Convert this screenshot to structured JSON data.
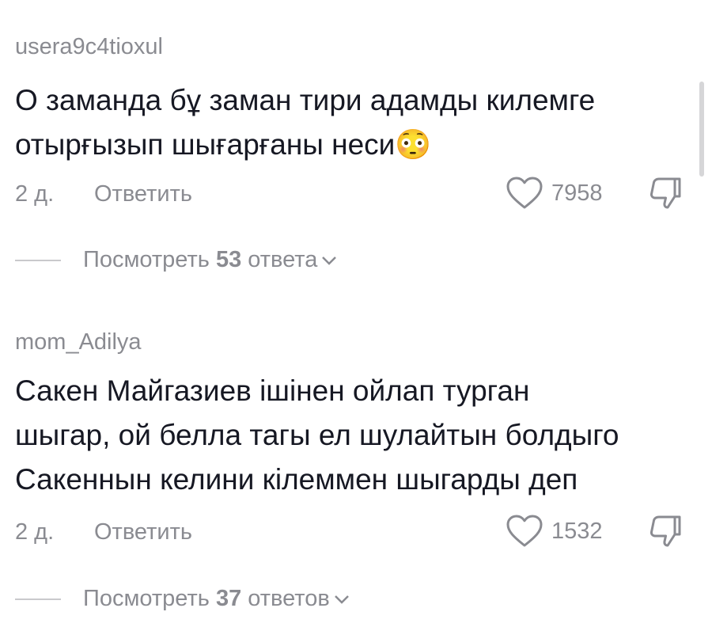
{
  "comments": [
    {
      "username": "usera9c4tioxul",
      "text_lines": [
        "О заманда бұ заман тири адамды килемге",
        "отырғызып шығарғаны неси😳"
      ],
      "time": "2 д.",
      "reply_label": "Ответить",
      "like_count": "7958",
      "replies_prefix": "Посмотреть ",
      "replies_count": "53",
      "replies_suffix": " ответа"
    },
    {
      "username": "mom_Adilya",
      "text_lines": [
        "Сакен Майгазиев ішінен ойлап турган",
        "шыгар, ой белла тагы ел шулайтын болдыго",
        "Сакеннын келини кілеммен шыгарды деп"
      ],
      "time": "2 д.",
      "reply_label": "Ответить",
      "like_count": "1532",
      "replies_prefix": "Посмотреть ",
      "replies_count": "37",
      "replies_suffix": " ответов"
    }
  ],
  "icons": {
    "like": "heart-outline-icon",
    "dislike": "thumbs-down-icon",
    "expand": "chevron-down-icon"
  }
}
